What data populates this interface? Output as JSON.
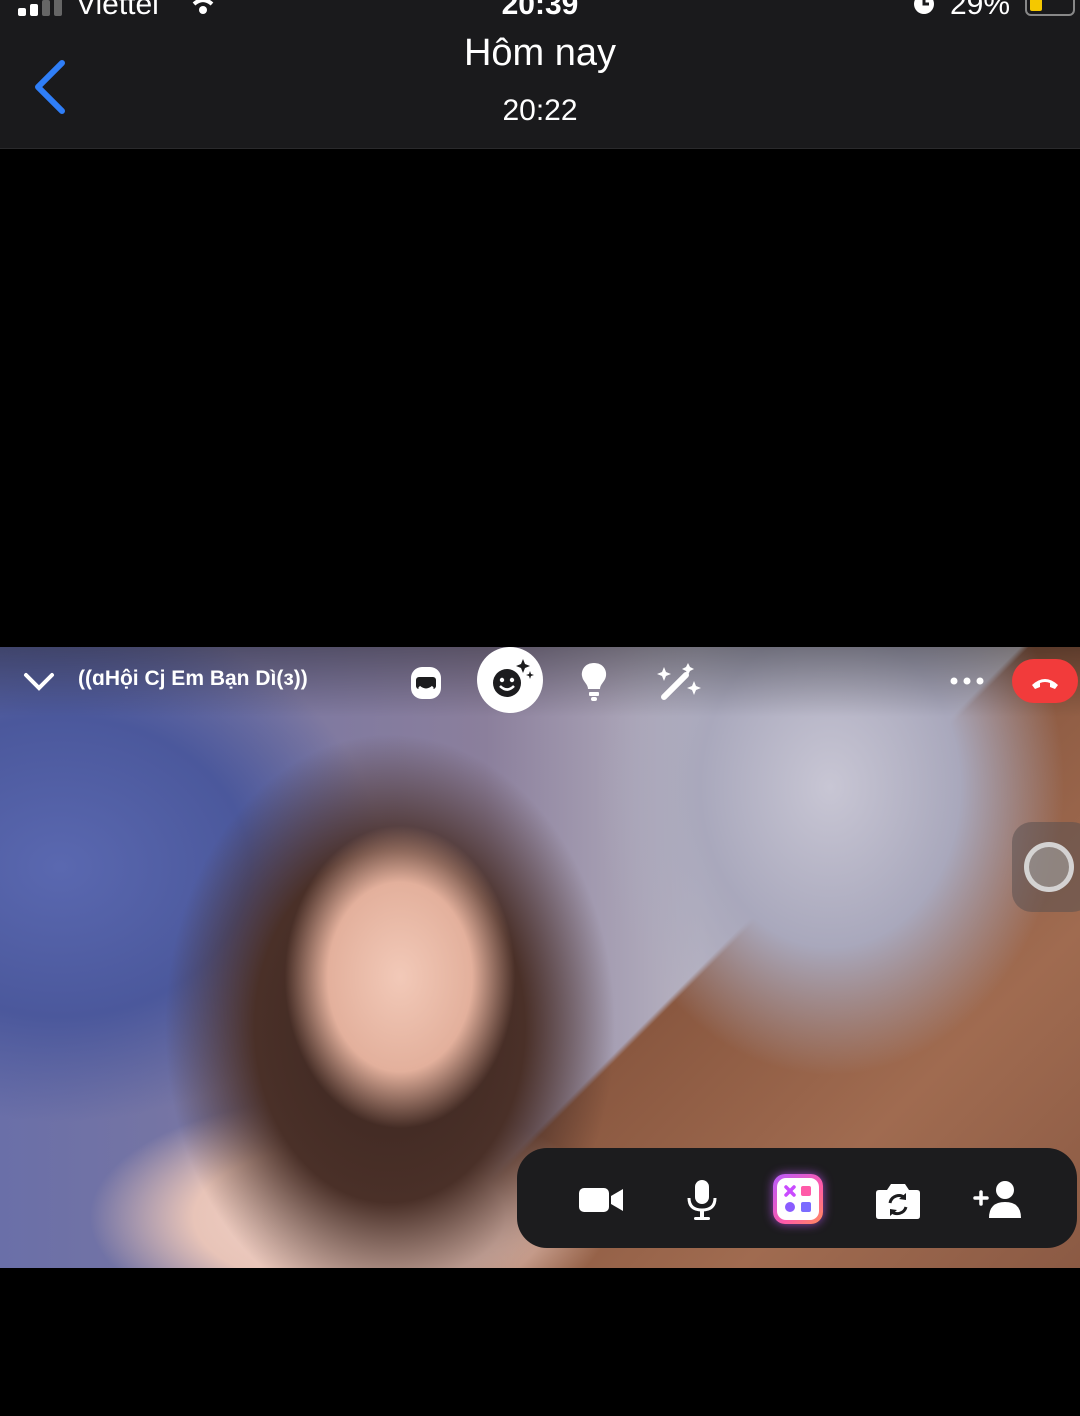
{
  "status_bar": {
    "carrier": "Viettel",
    "time": "20:39",
    "battery": "29%",
    "battery_level": 0.29
  },
  "header": {
    "title": "Hôm nay",
    "subtitle": "20:22",
    "back_icon": "chevron-left-icon",
    "accent": "#2f7ef7"
  },
  "call": {
    "group_name": "((ɑHội Cj Em Bạn Dì(ɜ))",
    "top_controls": [
      "chevron-down-icon",
      "avatar-icon",
      "effects-icon",
      "lightbulb-icon",
      "magic-wand-icon",
      "more-icon",
      "end-call-icon"
    ],
    "end_call_color": "#f23b3b",
    "toolbar": [
      "video-camera-icon",
      "microphone-icon",
      "apps-icon",
      "flip-camera-icon",
      "add-person-icon"
    ]
  }
}
